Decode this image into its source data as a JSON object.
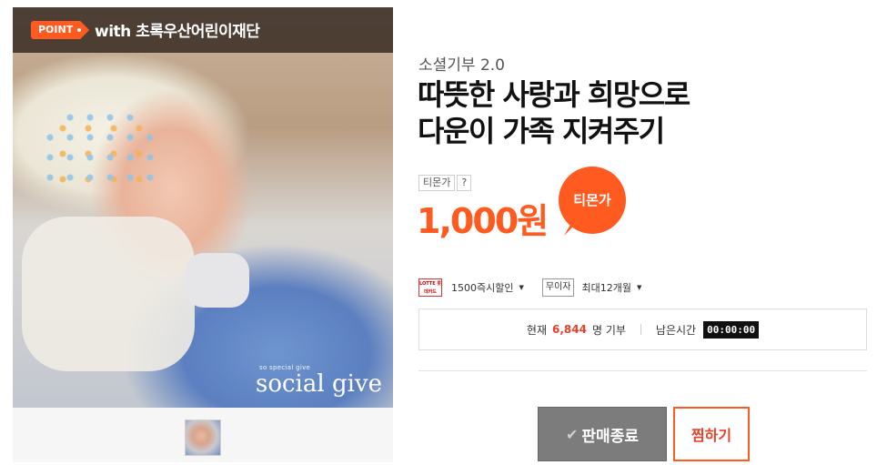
{
  "photo": {
    "point_tag": "POINT",
    "with_text": "with 초록우산어린이재단",
    "brand_small": "so special give",
    "brand_big": "social give"
  },
  "product": {
    "category": "소셜기부 2.0",
    "title_line1": "따뜻한 사랑과 희망으로",
    "title_line2": "다운이 가족 지켜주기"
  },
  "price": {
    "label": "티몬가",
    "help": "?",
    "value": "1,000원",
    "badge": "티몬가"
  },
  "benefits": {
    "card_logo": "LOTTE 롯데카드",
    "card_text": "1500즉시할인",
    "muija_label": "무이자",
    "muija_text": "최대12개월"
  },
  "status": {
    "current_prefix": "현재",
    "count": "6,844",
    "count_suffix": "명 기부",
    "remaining_label": "남은시간",
    "timer": "00:00:00"
  },
  "buttons": {
    "soldout": "판매종료",
    "wish": "찜하기"
  },
  "colors": {
    "accent": "#ff5a1f",
    "count": "#e8412a",
    "soldout_bg": "#7c7c7c"
  }
}
